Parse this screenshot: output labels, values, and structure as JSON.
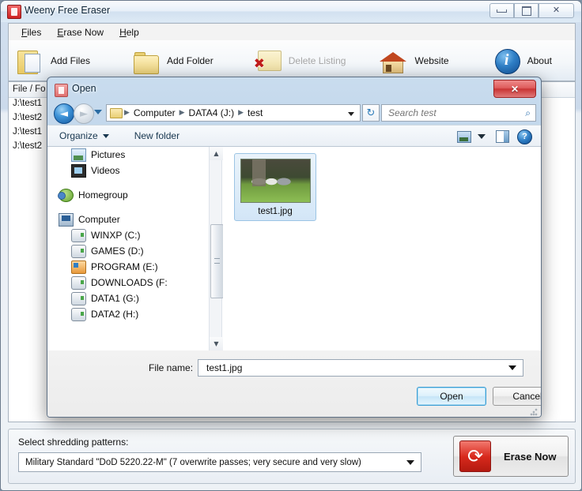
{
  "main_window": {
    "title": "Weeny Free Eraser",
    "icon": "eraser-app-icon",
    "controls": {
      "minimize": "minimize-icon",
      "maximize": "maximize-icon",
      "close": "✕"
    },
    "menubar": [
      {
        "label": "Files",
        "accesskey": "F"
      },
      {
        "label": "Erase Now",
        "accesskey": "E"
      },
      {
        "label": "Help",
        "accesskey": "H"
      }
    ],
    "toolbar": [
      {
        "label": "Add Files",
        "icon": "folder-document-icon",
        "enabled": true
      },
      {
        "label": "Add Folder",
        "icon": "folder-icon",
        "enabled": true
      },
      {
        "label": "Delete Listing",
        "icon": "folder-delete-icon",
        "enabled": false
      },
      {
        "label": "Website",
        "icon": "house-icon",
        "enabled": true
      },
      {
        "label": "About",
        "icon": "info-icon",
        "enabled": true
      }
    ],
    "file_list": {
      "columns": [
        "File / Fo",
        "",
        ""
      ],
      "rows": [
        "J:\\test1",
        "J:\\test2",
        "J:\\test1",
        "J:\\test2"
      ]
    },
    "bottom": {
      "shred_label": "Select shredding patterns:",
      "shred_value": "Military Standard \"DoD 5220.22-M\" (7 overwrite passes; very secure and very slow)",
      "erase_button": "Erase Now",
      "erase_icon": "recycle-arrows-icon"
    }
  },
  "open_dialog": {
    "title": "Open",
    "icon": "eraser-app-icon",
    "close_label": "✕",
    "nav": {
      "back": "back-arrow-icon",
      "back_glyph": "◄",
      "forward": "forward-arrow-icon",
      "forward_glyph": "►",
      "history": "history-dropdown-icon",
      "refresh_glyph": "↻",
      "breadcrumbs": [
        "Computer",
        "DATA4 (J:)",
        "test"
      ],
      "separator": "▶"
    },
    "search": {
      "placeholder": "Search test",
      "value": "",
      "icon": "search-icon"
    },
    "organize": {
      "organize_label": "Organize",
      "new_folder_label": "New folder",
      "view_icon": "view-mode-icon",
      "pane_icon": "preview-pane-icon",
      "help_icon": "help-icon",
      "help_glyph": "?"
    },
    "tree": [
      {
        "label": "Pictures",
        "icon": "pictures-icon",
        "indent": true
      },
      {
        "label": "Videos",
        "icon": "videos-icon",
        "indent": true
      },
      {
        "label": "Homegroup",
        "icon": "homegroup-icon",
        "indent": false
      },
      {
        "label": "Computer",
        "icon": "computer-icon",
        "indent": false
      },
      {
        "label": "WINXP (C:)",
        "icon": "drive-icon",
        "indent": true
      },
      {
        "label": "GAMES (D:)",
        "icon": "drive-icon",
        "indent": true
      },
      {
        "label": "PROGRAM (E:)",
        "icon": "program-drive-icon",
        "indent": true
      },
      {
        "label": "DOWNLOADS (F:",
        "icon": "drive-icon",
        "indent": true
      },
      {
        "label": "DATA1 (G:)",
        "icon": "drive-icon",
        "indent": true
      },
      {
        "label": "DATA2 (H:)",
        "icon": "drive-icon",
        "indent": true
      }
    ],
    "scrollbar": {
      "up_glyph": "▲",
      "down_glyph": "▼"
    },
    "files": [
      {
        "name": "test1.jpg",
        "icon": "image-thumbnail",
        "selected": true
      }
    ],
    "footer": {
      "file_name_label": "File name:",
      "file_name_value": "test1.jpg",
      "open_button": "Open",
      "cancel_button": "Cancel"
    }
  },
  "colors": {
    "accent_blue": "#3c9ed4",
    "close_red": "#c93434",
    "erase_red": "#d8291c",
    "window_chrome": "#cbdaeb"
  }
}
